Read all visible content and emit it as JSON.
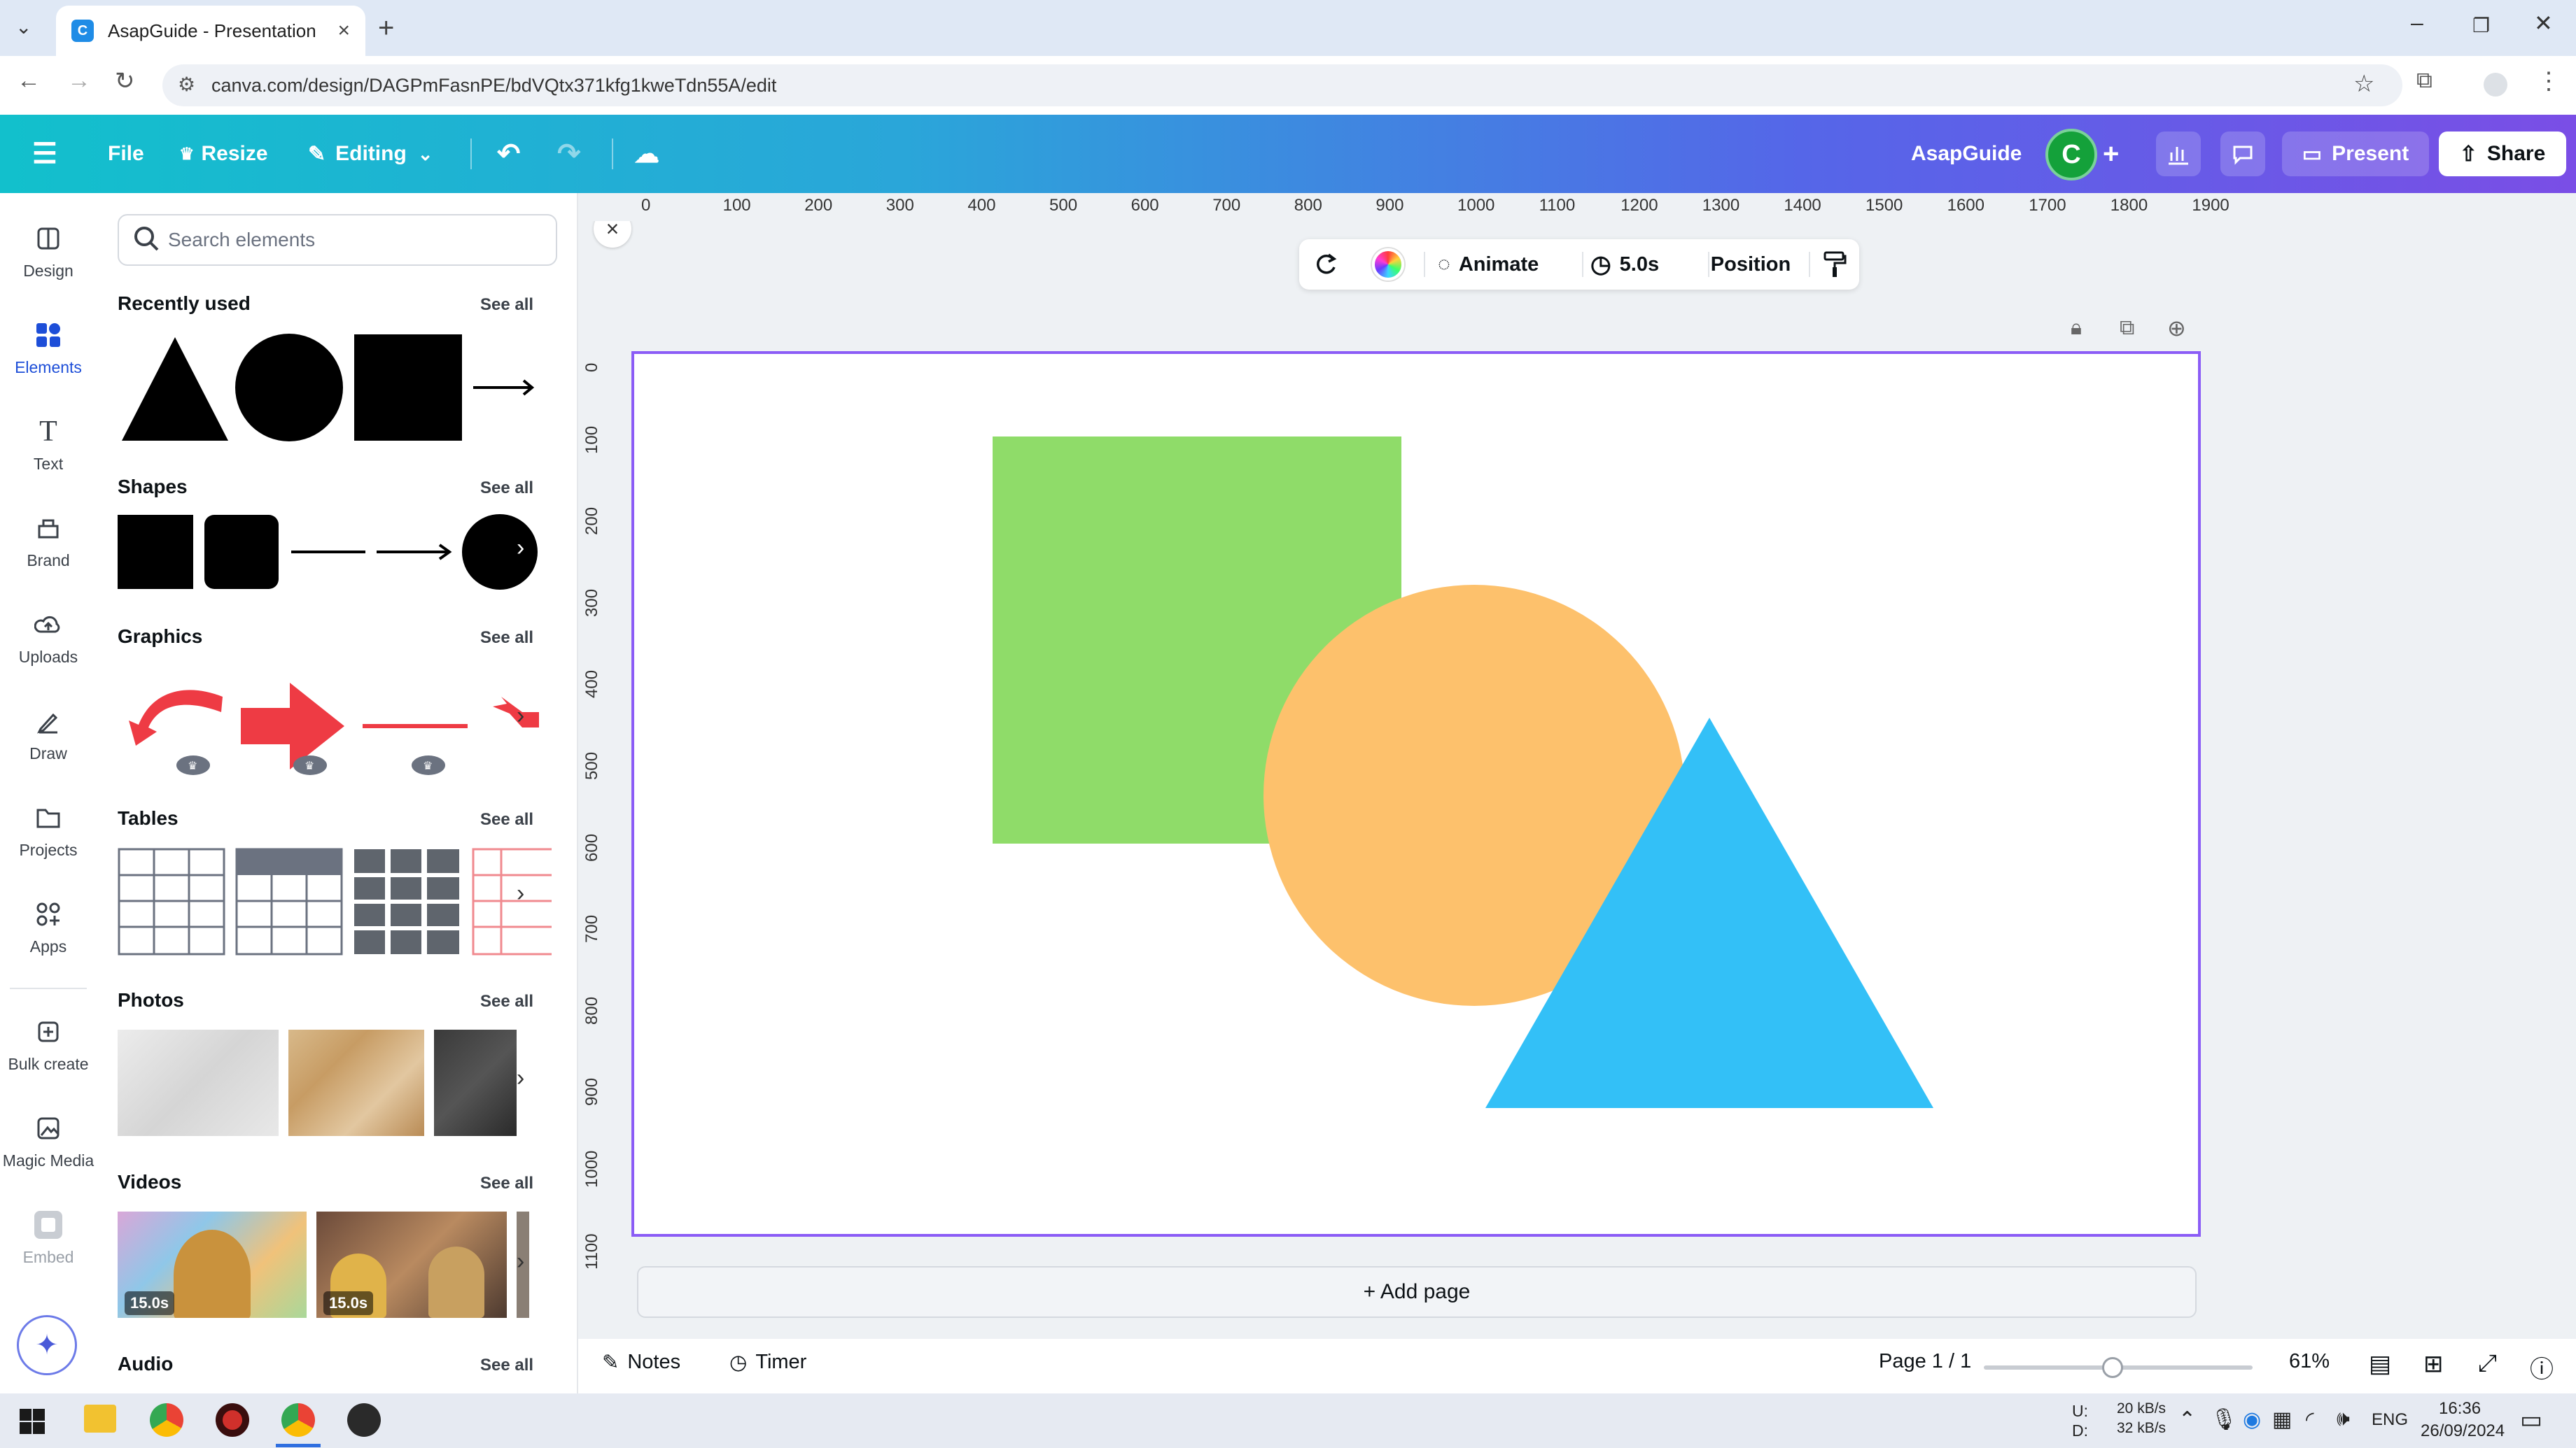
{
  "browser": {
    "tab_title": "AsapGuide - Presentation",
    "url": "canva.com/design/DAGPmFasnPE/bdVQtx371kfg1kweTdn55A/edit"
  },
  "topbar": {
    "file": "File",
    "resize": "Resize",
    "editing": "Editing",
    "team_name": "AsapGuide",
    "avatar_letter": "C",
    "present": "Present",
    "share": "Share"
  },
  "rail": {
    "design": "Design",
    "elements": "Elements",
    "text": "Text",
    "brand": "Brand",
    "uploads": "Uploads",
    "draw": "Draw",
    "projects": "Projects",
    "apps": "Apps",
    "bulk_create": "Bulk create",
    "magic_media": "Magic Media",
    "embed": "Embed"
  },
  "panel": {
    "search_placeholder": "Search elements",
    "see_all": "See all",
    "sections": {
      "recently_used": "Recently used",
      "shapes": "Shapes",
      "graphics": "Graphics",
      "tables": "Tables",
      "photos": "Photos",
      "videos": "Videos",
      "audio": "Audio"
    },
    "video_durations": [
      "15.0s",
      "15.0s"
    ]
  },
  "floatbar": {
    "animate": "Animate",
    "duration": "5.0s",
    "position": "Position"
  },
  "ruler": {
    "horizontal": [
      "0",
      "100",
      "200",
      "300",
      "400",
      "500",
      "600",
      "700",
      "800",
      "900",
      "1000",
      "1100",
      "1200",
      "1300",
      "1400",
      "1500",
      "1600",
      "1700",
      "1800",
      "1900"
    ],
    "vertical": [
      "0",
      "100",
      "200",
      "300",
      "400",
      "500",
      "600",
      "700",
      "800",
      "900",
      "1000",
      "1100"
    ]
  },
  "canvas": {
    "add_page": "+ Add page",
    "colors": {
      "square": "#8fdc69",
      "circle": "#fdc16c",
      "triangle": "#33c0f7",
      "selection": "#8b5cf6"
    }
  },
  "bottombar": {
    "notes": "Notes",
    "timer": "Timer",
    "page_indicator": "Page 1 / 1",
    "zoom": "61%",
    "zoom_fraction": 0.48
  },
  "taskbar": {
    "net_up": "20 kB/s",
    "net_down": "32 kB/s",
    "drive_u": "U:",
    "drive_d": "D:",
    "lang": "ENG",
    "time": "16:36",
    "date": "26/09/2024"
  }
}
